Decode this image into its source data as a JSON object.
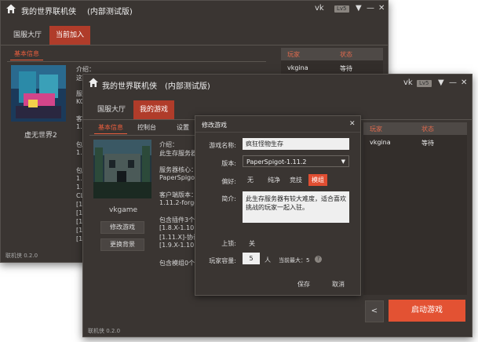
{
  "back_window": {
    "title": "我的世界联机侠",
    "subtitle": "(内部测试版)",
    "user": "vk",
    "level": "Lv5",
    "tabs": [
      "国服大厅",
      "当前加入"
    ],
    "subtab": "基本信息",
    "game_name": "虚无世界2",
    "info_lines": [
      "介绍：",
      "这…",
      "服",
      "KC",
      "客",
      "1.7",
      "包",
      "1.7",
      "包",
      "1.7",
      "1.7",
      "CL",
      "[1.7",
      "[1.7",
      "[1.7",
      "[1.7",
      "[1.7"
    ],
    "players_header": [
      "玩家",
      "状态"
    ],
    "players": [
      {
        "name": "vkgina",
        "status": "等待"
      }
    ],
    "footer": "联机侠 0.2.0"
  },
  "front_window": {
    "title": "我的世界联机侠",
    "subtitle": "(内部测试版)",
    "user": "vk",
    "level": "Lv5",
    "tabs": [
      "国服大厅",
      "我的游戏"
    ],
    "subtabs": [
      "基本信息",
      "控制台",
      "设置"
    ],
    "game_name": "vkgame",
    "edit_button": "修改游戏",
    "change_bg_button": "更换背景",
    "info": {
      "intro_label": "介绍：",
      "intro_text": "此生存服务器有",
      "core_label": "服务器核心：",
      "core_value": "PaperSpigot-1",
      "client_label": "客户端版本：",
      "client_value": "1.11.2-forge1",
      "plugins_label": "包含插件3个：",
      "plugins": [
        "[1.8.X-1.10.X]",
        "[1.11.X]-协议库",
        "[1.9.X-1.10.X]"
      ],
      "mods_label": "包含模组0个："
    },
    "players_header": [
      "玩家",
      "状态"
    ],
    "players": [
      {
        "name": "vkgina",
        "status": "等待"
      }
    ],
    "back_button": "<",
    "start_button": "启动游戏",
    "footer": "联机侠 0.2.0"
  },
  "dialog": {
    "title": "修改游戏",
    "close": "✕",
    "name_label": "游戏名称:",
    "name_value": "疯狂怪物生存",
    "version_label": "版本:",
    "version_value": "PaperSpigot-1.11.2",
    "pref_label": "偏好:",
    "prefs": [
      "无",
      "纯净",
      "竞技",
      "模组"
    ],
    "pref_selected": 3,
    "desc_label": "简介:",
    "desc_value": "此生存服务器有较大难度，适合喜欢挑战的玩家一起入驻。",
    "lock_label": "上锁:",
    "lock_value": "关",
    "capacity_label": "玩家容量:",
    "capacity_value": "5",
    "capacity_unit": "人",
    "max_text": "当前最大：5",
    "help": "?",
    "save": "保存",
    "cancel": "取消"
  },
  "colors": {
    "accent": "#b03c2a",
    "start": "#e35233",
    "bg": "#3a3532"
  }
}
